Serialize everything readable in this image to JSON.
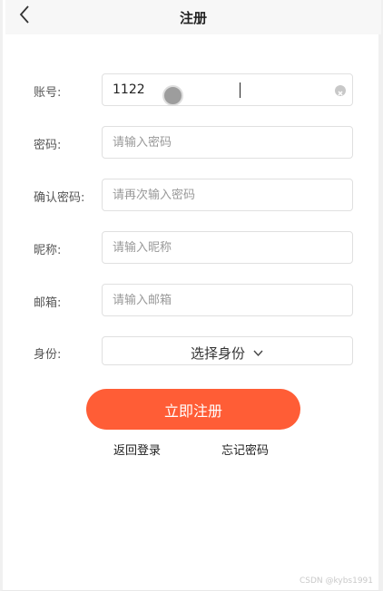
{
  "header": {
    "title": "注册"
  },
  "form": {
    "account": {
      "label": "账号:",
      "value": "1122",
      "placeholder": ""
    },
    "password": {
      "label": "密码:",
      "placeholder": "请输入密码"
    },
    "confirm": {
      "label": "确认密码:",
      "placeholder": "请再次输入密码"
    },
    "nickname": {
      "label": "昵称:",
      "placeholder": "请输入昵称"
    },
    "email": {
      "label": "邮箱:",
      "placeholder": "请输入邮箱"
    },
    "identity": {
      "label": "身份:",
      "selected": "选择身份"
    }
  },
  "actions": {
    "submit_label": "立即注册",
    "back_login": "返回登录",
    "forgot": "忘记密码"
  },
  "watermark": "CSDN @kybs1991",
  "colors": {
    "accent": "#ff5d36"
  },
  "icons": {
    "back": "chevron-left-icon",
    "clear": "clear-circle-icon",
    "dropdown": "chevron-down-icon"
  }
}
